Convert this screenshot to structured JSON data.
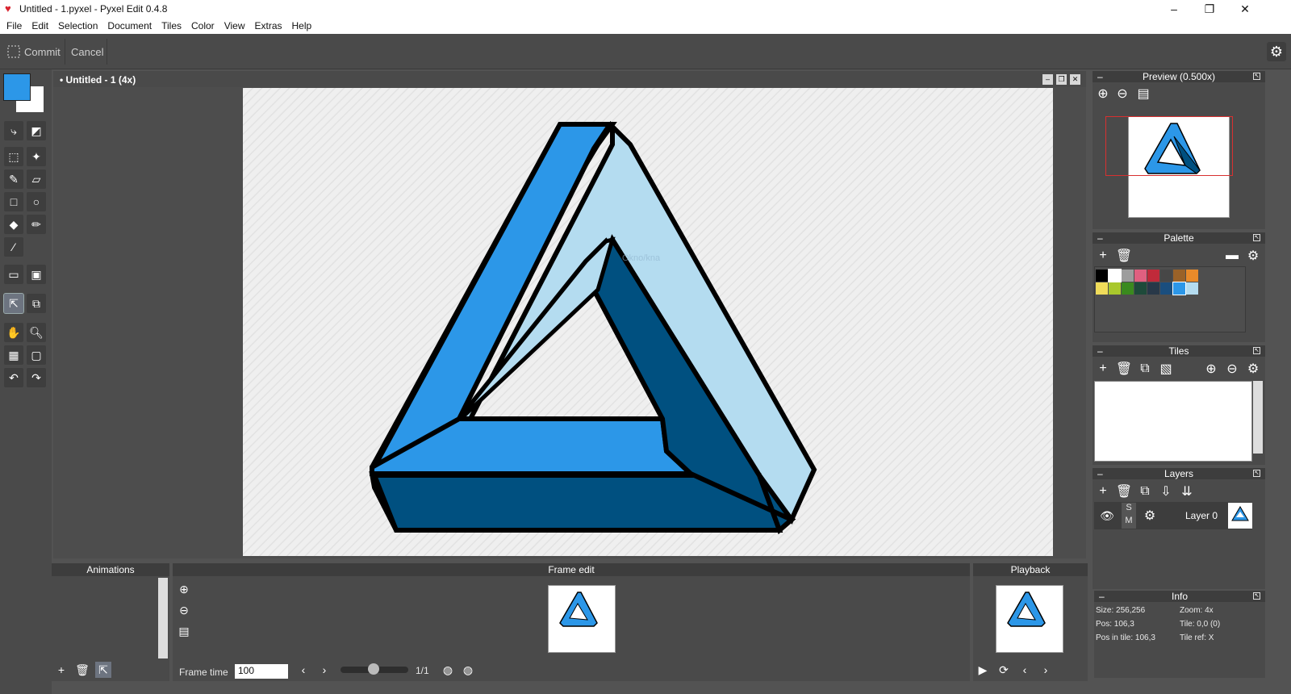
{
  "titlebar": {
    "title": "Untitled - 1.pyxel - Pyxel Edit 0.4.8",
    "minimize": "–",
    "maximize": "❐",
    "close": "✕"
  },
  "menu": [
    "File",
    "Edit",
    "Selection",
    "Document",
    "Tiles",
    "Color",
    "View",
    "Extras",
    "Help"
  ],
  "toolbar": {
    "commit": "Commit",
    "cancel": "Cancel"
  },
  "colors": {
    "primary": "#2c97e8",
    "secondary": "#ffffff",
    "accent_blue": "#2c97e8",
    "light_blue": "#b4dcf0",
    "dark_blue": "#005080"
  },
  "document": {
    "title": "• Untitled - 1   (4x)",
    "watermark": "Okno/kna"
  },
  "preview": {
    "title": "Preview (0.500x)"
  },
  "palette": {
    "title": "Palette",
    "colors": [
      "#000000",
      "#ffffff",
      "#9d9d9d",
      "#e06080",
      "#c02a3a",
      "#474747",
      "#9a6228",
      "#e88a2a",
      "#f0dc5a",
      "#a9c82c",
      "#3a8a1e",
      "#1e4a3a",
      "#283848",
      "#1a4e7e",
      "#2c97e8",
      "#b4dcf0"
    ]
  },
  "tiles": {
    "title": "Tiles"
  },
  "layers": {
    "title": "Layers",
    "items": [
      {
        "name": "Layer 0",
        "solo": "S",
        "mute": "M"
      }
    ]
  },
  "info": {
    "title": "Info",
    "size": "Size: 256,256",
    "zoom": "Zoom: 4x",
    "pos": "Pos: 106,3",
    "tile": "Tile: 0,0 (0)",
    "pos_in_tile": "Pos in tile: 106,3",
    "tile_ref": "Tile ref: X"
  },
  "animations": {
    "title": "Animations"
  },
  "frame_edit": {
    "title": "Frame edit",
    "frame_time_label": "Frame time",
    "frame_time_value": "100",
    "frame_counter": "1/1"
  },
  "playback": {
    "title": "Playback"
  }
}
